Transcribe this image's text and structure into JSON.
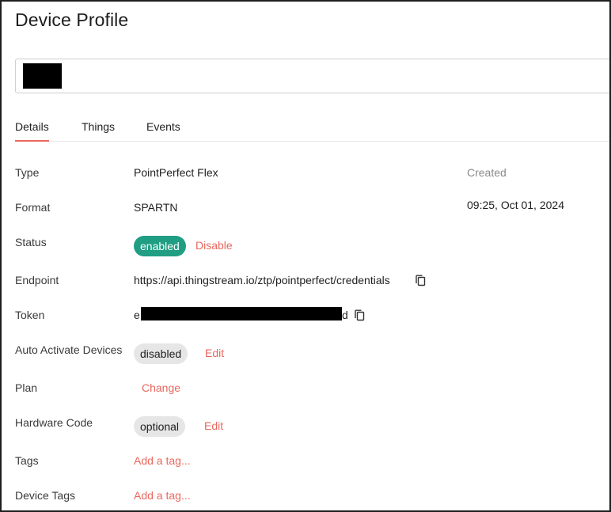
{
  "page": {
    "title": "Device Profile"
  },
  "name_field": {
    "value": ""
  },
  "tabs": [
    {
      "label": "Details",
      "active": true
    },
    {
      "label": "Things",
      "active": false
    },
    {
      "label": "Events",
      "active": false
    }
  ],
  "details": {
    "type": {
      "label": "Type",
      "value": "PointPerfect Flex"
    },
    "format": {
      "label": "Format",
      "value": "SPARTN"
    },
    "status": {
      "label": "Status",
      "badge": "enabled",
      "action": "Disable"
    },
    "endpoint": {
      "label": "Endpoint",
      "value": "https://api.thingstream.io/ztp/pointperfect/credentials"
    },
    "token": {
      "label": "Token",
      "prefix": "e",
      "suffix": "d"
    },
    "auto_activate": {
      "label": "Auto Activate Devices",
      "badge": "disabled",
      "action": "Edit"
    },
    "plan": {
      "label": "Plan",
      "action": "Change"
    },
    "hardware_code": {
      "label": "Hardware Code",
      "badge": "optional",
      "action": "Edit"
    },
    "tags": {
      "label": "Tags",
      "action": "Add a tag..."
    },
    "device_tags": {
      "label": "Device Tags",
      "action": "Add a tag..."
    }
  },
  "created": {
    "label": "Created",
    "value": "09:25, Oct 01, 2024"
  },
  "colors": {
    "accent": "#e9685e",
    "enabled_badge": "#1f9e83",
    "neutral_badge": "#e6e6e6"
  },
  "icons": [
    "copy-icon"
  ]
}
